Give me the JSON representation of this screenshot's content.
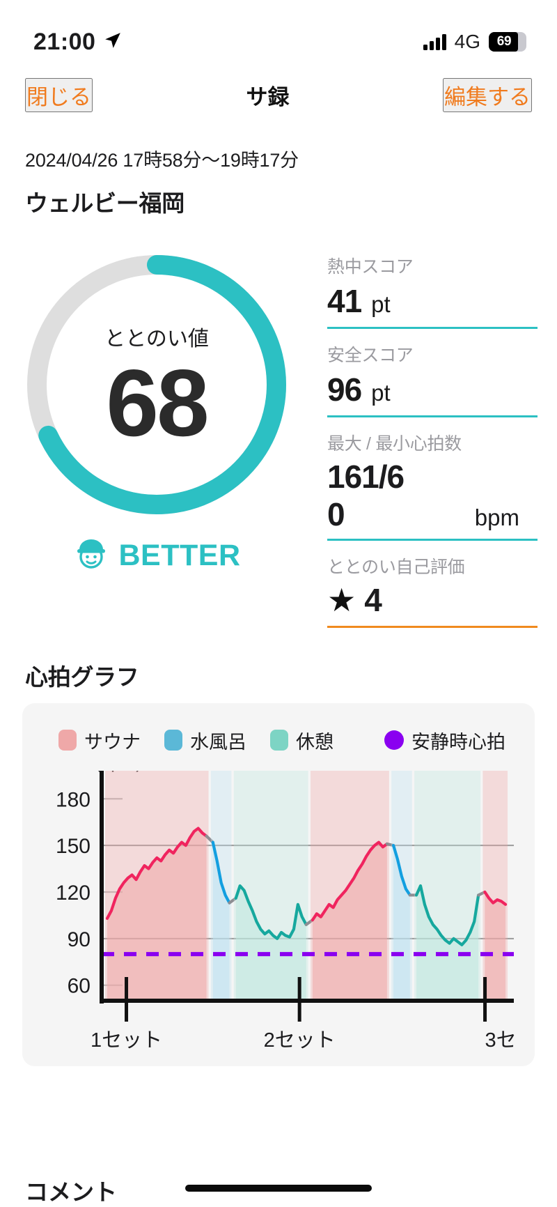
{
  "status_bar": {
    "time": "21:00",
    "location_icon": "location-arrow-icon",
    "signal_icon": "signal-bars-icon",
    "network": "4G",
    "battery_percent": "69",
    "battery_level": 69
  },
  "nav": {
    "close_label": "閉じる",
    "title": "サ録",
    "edit_label": "編集する",
    "accent_color": "#F07B1E"
  },
  "header": {
    "date_range": "2024/04/26 17時58分〜19時17分",
    "venue": "ウェルビー福岡"
  },
  "gauge": {
    "label": "ととのい値",
    "value": "68",
    "value_number": 68,
    "max": 100,
    "track_color": "#DEDEDE",
    "arc_color": "#2CC0C3",
    "badge_text": "BETTER",
    "badge_icon": "sauna-hat-face-icon"
  },
  "stats": [
    {
      "label": "熱中スコア",
      "value": "41",
      "unit": "pt",
      "rule_color": "#2CC0C3"
    },
    {
      "label": "安全スコア",
      "value": "96",
      "unit": "pt",
      "rule_color": "#2CC0C3"
    },
    {
      "label": "最大 / 最小心拍数",
      "value_line1": "161/6",
      "value_line2": "0",
      "unit": "bpm",
      "rule_color": "#2CC0C3"
    },
    {
      "label": "ととのい自己評価",
      "star": "★",
      "value": "4",
      "rule_color": "#F08A1E"
    }
  ],
  "chart_section": {
    "title": "心拍グラフ"
  },
  "comment_section": {
    "title": "コメント"
  },
  "chart_data": {
    "type": "line",
    "title": "心拍グラフ",
    "ylabel": "(bpm)",
    "xlabel": "",
    "ylim": [
      50,
      190
    ],
    "yticks": [
      180,
      150,
      120,
      90,
      60
    ],
    "ytick_labels": [
      "180",
      "150",
      "120",
      "90",
      "60"
    ],
    "gridlines": [
      150,
      90
    ],
    "grid": true,
    "legend_position": "top",
    "legend": [
      {
        "label": "サウナ",
        "color": "#EFA8A8",
        "icon": "rounded-square-swatch"
      },
      {
        "label": "水風呂",
        "color": "#5BB8D7",
        "icon": "rounded-square-swatch"
      },
      {
        "label": "休憩",
        "color": "#7DD4C4",
        "icon": "rounded-square-swatch"
      },
      {
        "label": "安静時心拍",
        "color": "#8A00F0",
        "icon": "circle-swatch"
      }
    ],
    "xtick_labels": [
      "1セット",
      "2セット",
      "3セ"
    ],
    "xtick_positions": [
      0.06,
      0.48,
      0.93
    ],
    "resting_hr": 80,
    "resting_hr_line_color": "#8A00F0",
    "resting_hr_line_style": "dashed",
    "series": [
      {
        "name": "サウナ",
        "line_color": "#F0245E",
        "fill_color": "#EFA8A8",
        "values": [
          103,
          108,
          116,
          122,
          126,
          129,
          131,
          128,
          133,
          137,
          135,
          139,
          142,
          140,
          144,
          147,
          145,
          149,
          152,
          150,
          155,
          159,
          161,
          158,
          156
        ]
      },
      {
        "name": "水風呂",
        "line_color": "#139FE0",
        "fill_color": "#BEE2F0",
        "values": [
          152,
          140,
          126,
          118,
          113
        ]
      },
      {
        "name": "休憩",
        "line_color": "#16A89E",
        "fill_color": "#BEE8DF",
        "values": [
          116,
          124,
          121,
          114,
          108,
          101,
          96,
          93,
          95,
          92,
          90,
          94,
          92,
          91,
          96,
          112,
          104,
          99
        ]
      },
      {
        "name": "サウナ2",
        "line_color": "#F0245E",
        "fill_color": "#EFA8A8",
        "values": [
          102,
          106,
          104,
          108,
          112,
          110,
          115,
          118,
          121,
          125,
          129,
          134,
          138,
          143,
          147,
          150,
          152,
          149,
          151
        ]
      },
      {
        "name": "水風呂2",
        "line_color": "#139FE0",
        "fill_color": "#BEE2F0",
        "values": [
          150,
          141,
          130,
          122,
          118
        ]
      },
      {
        "name": "休憩2",
        "line_color": "#16A89E",
        "fill_color": "#BEE8DF",
        "values": [
          118,
          124,
          112,
          104,
          99,
          96,
          92,
          89,
          87,
          90,
          88,
          86,
          89,
          94,
          101,
          118
        ]
      },
      {
        "name": "サウナ3",
        "line_color": "#F0245E",
        "fill_color": "#EFA8A8",
        "values": [
          120,
          116,
          113,
          115,
          114,
          112
        ]
      }
    ],
    "series_order_note": "3 sauna/cold-bath/rest cycles plotted left to right",
    "max_hr": 161,
    "min_hr": 60
  }
}
